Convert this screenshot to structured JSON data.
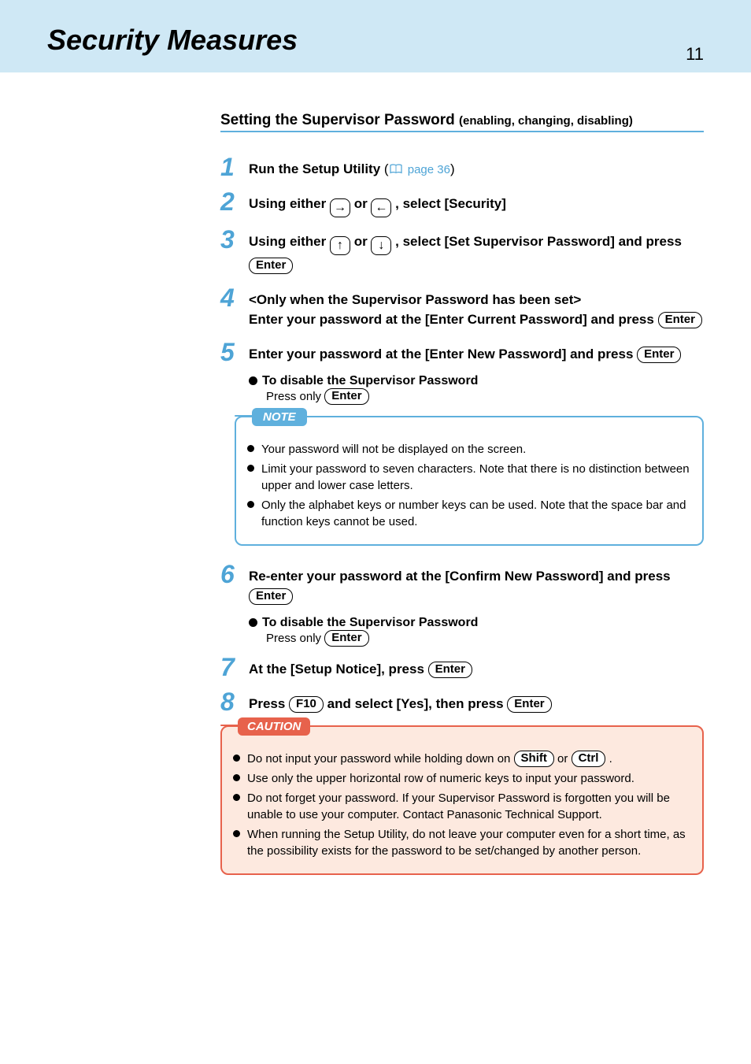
{
  "header": {
    "title": "Security Measures",
    "page_number": "11"
  },
  "section": {
    "title": "Setting the Supervisor Password ",
    "subtitle": "(enabling, changing, disabling)"
  },
  "steps": {
    "s1": {
      "num": "1",
      "text_a": "Run the Setup Utility ",
      "pageref": " page 36"
    },
    "s2": {
      "num": "2",
      "text_a": "Using either ",
      "text_b": " or ",
      "text_c": " , select [Security]"
    },
    "s3": {
      "num": "3",
      "text_a": "Using either ",
      "text_b": " or ",
      "text_c": " , select [Set Supervisor Password] and press  ",
      "enter": "Enter"
    },
    "s4": {
      "num": "4",
      "line1": "<Only when the Supervisor Password has been set>",
      "line2": "Enter your password at the [Enter Current Password] and press ",
      "enter": "Enter"
    },
    "s5": {
      "num": "5",
      "line1": "Enter your password at the [Enter New Password] and press ",
      "enter": "Enter",
      "disable_head": "To disable the Supervisor Password",
      "disable_body": "Press only ",
      "disable_enter": "Enter"
    },
    "s6": {
      "num": "6",
      "line1": "Re-enter your password at the [Confirm New Password] and press  ",
      "enter": "Enter",
      "disable_head": "To disable the Supervisor Password",
      "disable_body": "Press only ",
      "disable_enter": "Enter"
    },
    "s7": {
      "num": "7",
      "text_a": "At the [Setup Notice], press ",
      "enter": "Enter"
    },
    "s8": {
      "num": "8",
      "text_a": "Press ",
      "f10": "F10",
      "text_b": " and select [Yes], then press ",
      "enter": "Enter"
    }
  },
  "note": {
    "label": "NOTE",
    "items": [
      "Your password will not be displayed on the screen.",
      "Limit your password to seven characters.  Note that there is no distinction between upper and lower case letters.",
      "Only the alphabet keys or number keys can be used.  Note that the space bar and function keys cannot be used."
    ]
  },
  "caution": {
    "label": "CAUTION",
    "item1_a": "Do not input your password while holding down on ",
    "item1_shift": "Shift",
    "item1_b": " or  ",
    "item1_ctrl": "Ctrl",
    "item1_c": " .",
    "items_rest": [
      "Use only the upper horizontal row of numeric keys to input your password.",
      "Do not forget your password.  If your Supervisor Password is forgotten you will be unable to use your computer. Contact Panasonic Technical Support.",
      "When running the Setup Utility, do not leave your computer even for a short time, as the possibility exists for the password to be set/changed by another person."
    ]
  }
}
